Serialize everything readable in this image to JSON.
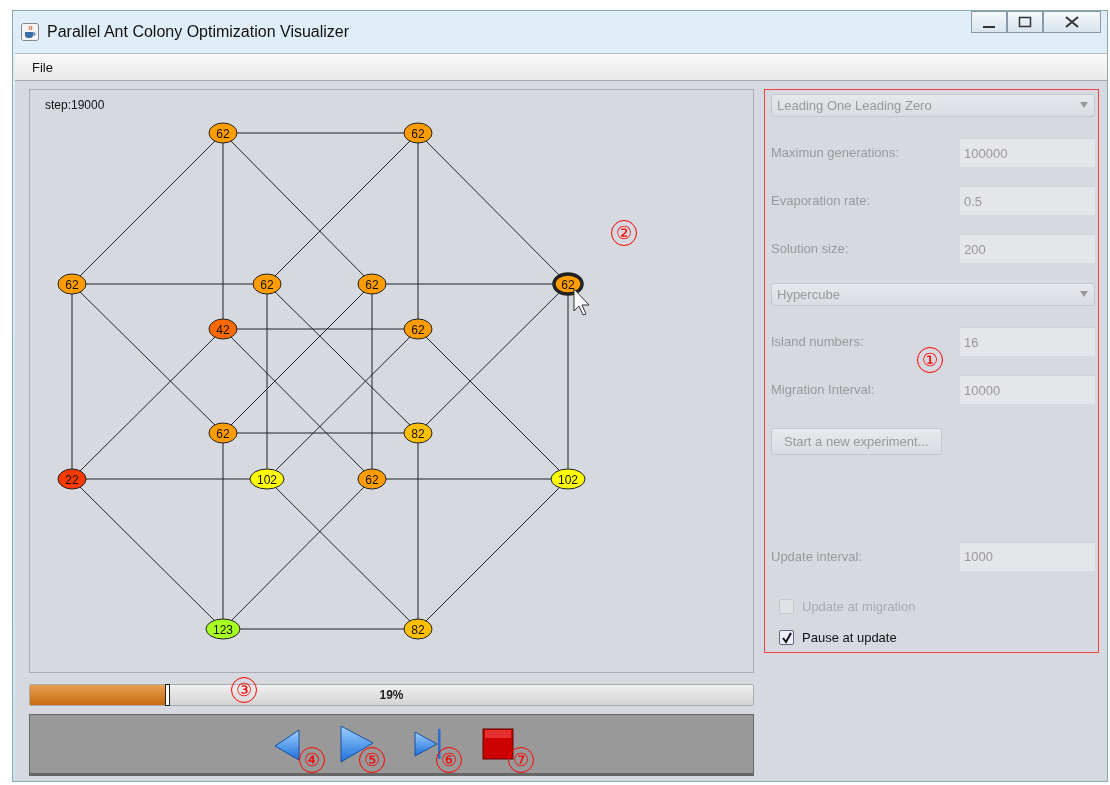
{
  "window": {
    "title": "Parallel Ant Colony Optimization Visualizer"
  },
  "menu": [
    {
      "label": "File"
    }
  ],
  "canvas": {
    "step": "step:19000",
    "nodes": [
      {
        "label": "62",
        "color": "#ff9c00",
        "selected": false
      },
      {
        "label": "62",
        "color": "#ff9c00",
        "selected": false
      },
      {
        "label": "62",
        "color": "#ff9c00",
        "selected": false
      },
      {
        "label": "62",
        "color": "#ff9c00",
        "selected": false
      },
      {
        "label": "62",
        "color": "#ff9c00",
        "selected": false
      },
      {
        "label": "62",
        "color": "#ff9c00",
        "selected": true
      },
      {
        "label": "42",
        "color": "#ff6a00",
        "selected": false
      },
      {
        "label": "62",
        "color": "#ff9c00",
        "selected": false
      },
      {
        "label": "62",
        "color": "#ff9c00",
        "selected": false
      },
      {
        "label": "82",
        "color": "#ffc000",
        "selected": false
      },
      {
        "label": "22",
        "color": "#ff3a00",
        "selected": false
      },
      {
        "label": "102",
        "color": "#ffff00",
        "selected": false
      },
      {
        "label": "62",
        "color": "#ff9c00",
        "selected": false
      },
      {
        "label": "102",
        "color": "#ffff00",
        "selected": false
      },
      {
        "label": "123",
        "color": "#a8ff22",
        "selected": false
      },
      {
        "label": "82",
        "color": "#ffc000",
        "selected": false
      }
    ]
  },
  "settings": [
    {
      "kind": "select",
      "value": "Leading One Leading Zero"
    },
    {
      "kind": "field",
      "label": "Maximun generations:",
      "value": "100000"
    },
    {
      "kind": "field",
      "label": "Evaporation rate:",
      "value": "0.5"
    },
    {
      "kind": "field",
      "label": "Solution size:",
      "value": "200"
    },
    {
      "kind": "select",
      "value": "Hypercube"
    },
    {
      "kind": "field",
      "label": "Island numbers:",
      "value": "16"
    },
    {
      "kind": "field",
      "label": "Migration Interval:",
      "value": "10000"
    },
    {
      "kind": "button",
      "label": "Start a new experiment..."
    }
  ],
  "update": {
    "label": "Update interval:",
    "value": "1000",
    "options": [
      {
        "label": "Update at migration",
        "checked": false,
        "disabled": true
      },
      {
        "label": "Pause at update",
        "checked": true,
        "disabled": false
      }
    ]
  },
  "progress": {
    "level": 0.19,
    "reading": "19%"
  },
  "controls": [
    {
      "kind": "back"
    },
    {
      "kind": "play"
    },
    {
      "kind": "step"
    },
    {
      "kind": "stop"
    }
  ],
  "callouts": [
    {
      "label": "①"
    },
    {
      "label": "②"
    },
    {
      "label": "③"
    },
    {
      "label": "④"
    },
    {
      "label": "⑤"
    },
    {
      "label": "⑥"
    },
    {
      "label": "⑦"
    }
  ]
}
